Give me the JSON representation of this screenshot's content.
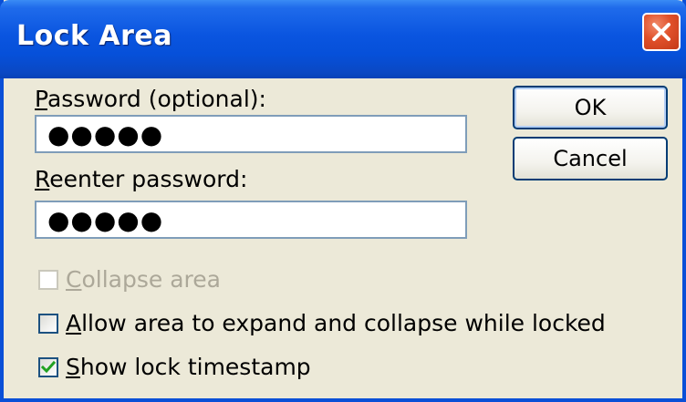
{
  "window": {
    "title": "Lock Area",
    "close_symbol": "✕"
  },
  "fields": {
    "password_label_mnemonic": "P",
    "password_label_rest": "assword (optional):",
    "password_value": "●●●●●",
    "reenter_label_mnemonic": "R",
    "reenter_label_rest": "eenter password:",
    "reenter_value": "●●●●●"
  },
  "buttons": {
    "ok_label": "OK",
    "cancel_label": "Cancel"
  },
  "checkboxes": {
    "collapse": {
      "mnemonic": "C",
      "rest": "ollapse area",
      "checked": false,
      "disabled": true
    },
    "allow_expand": {
      "mnemonic": "A",
      "rest": "llow area to expand and collapse while locked",
      "checked": false,
      "disabled": false
    },
    "show_timestamp": {
      "mnemonic": "S",
      "rest": "how lock timestamp",
      "checked": true,
      "disabled": false
    }
  },
  "colors": {
    "titlebar": "#0A55E0",
    "dialog_bg": "#ECE9D8",
    "close_button": "#E0502A",
    "check_mark": "#21A121",
    "disabled_text": "#ACA899"
  }
}
